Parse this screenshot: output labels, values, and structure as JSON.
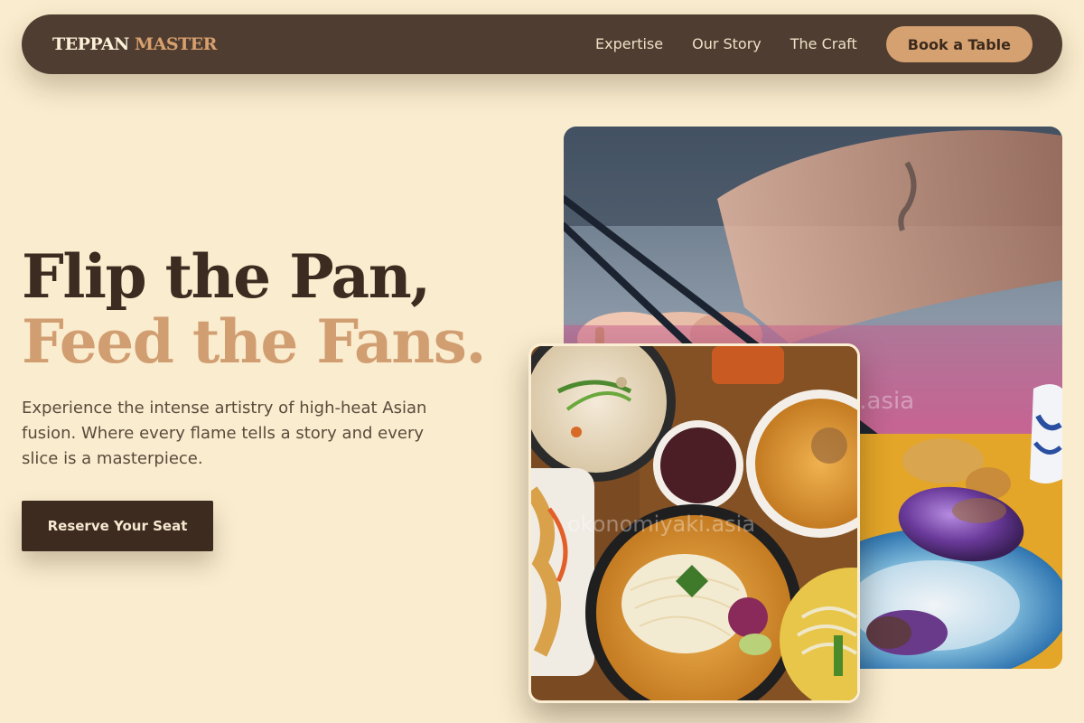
{
  "nav": {
    "logo_primary": "TEPPAN",
    "logo_secondary": "MASTER",
    "links": [
      "Expertise",
      "Our Story",
      "The Craft"
    ],
    "cta": "Book a Table"
  },
  "hero": {
    "headline_line1": "Flip the Pan,",
    "headline_line2": "Feed the Fans.",
    "subtitle": "Experience the intense artistry of high-heat Asian fusion. Where every flame tells a story and every slice is a masterpiece.",
    "cta": "Reserve Your Seat"
  },
  "images": {
    "back_watermark": "i.asia",
    "front_watermark": "okonomiyaki.asia"
  },
  "colors": {
    "background": "#faecce",
    "nav_bg": "#4e3d30",
    "accent": "#d6a171",
    "dark": "#3d2b20"
  }
}
